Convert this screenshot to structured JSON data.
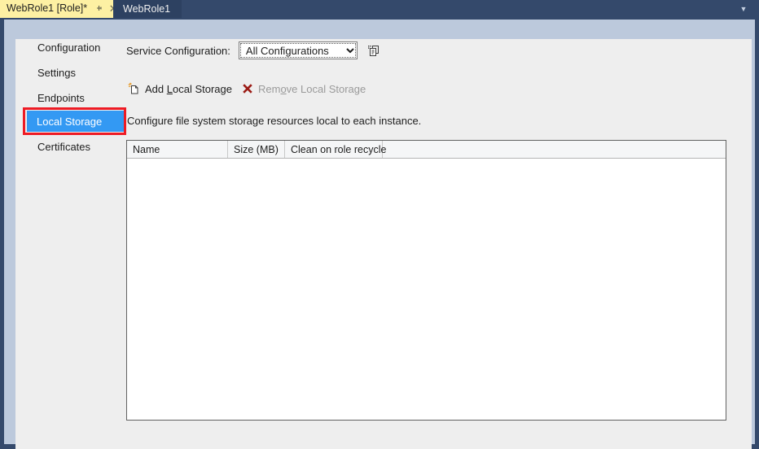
{
  "window": {
    "tabs": [
      {
        "title": "WebRole1 [Role]*",
        "active": true,
        "pin_icon": "pin-icon",
        "close_icon": "close-icon"
      },
      {
        "title": "WebRole1",
        "active": false
      }
    ],
    "tabstrip_overflow_icon": "chevron-down-icon"
  },
  "sidebar": {
    "items": [
      {
        "label": "Configuration",
        "selected": false
      },
      {
        "label": "Settings",
        "selected": false
      },
      {
        "label": "Endpoints",
        "selected": false
      },
      {
        "label": "Local Storage",
        "selected": true
      },
      {
        "label": "Certificates",
        "selected": false
      }
    ],
    "selection_highlight_color": "#3399f3",
    "annotation_color": "#ee1b24"
  },
  "main": {
    "service_configuration": {
      "label": "Service Configuration:",
      "value": "All Configurations",
      "options": [
        "All Configurations"
      ],
      "manage_icon": "copy-configuration-icon"
    },
    "toolbar": {
      "add_label_pre": "Add ",
      "add_label_accel": "L",
      "add_label_post": "ocal Storage",
      "add_icon": "new-local-storage-icon",
      "add_enabled": true,
      "remove_label_pre": "Rem",
      "remove_label_accel": "o",
      "remove_label_post": "ve Local Storage",
      "remove_icon": "red-x-delete-icon",
      "remove_enabled": false
    },
    "description": "Configure file system storage resources local to each instance.",
    "grid": {
      "columns": [
        "Name",
        "Size (MB)",
        "Clean on role recycle"
      ],
      "rows": []
    }
  }
}
